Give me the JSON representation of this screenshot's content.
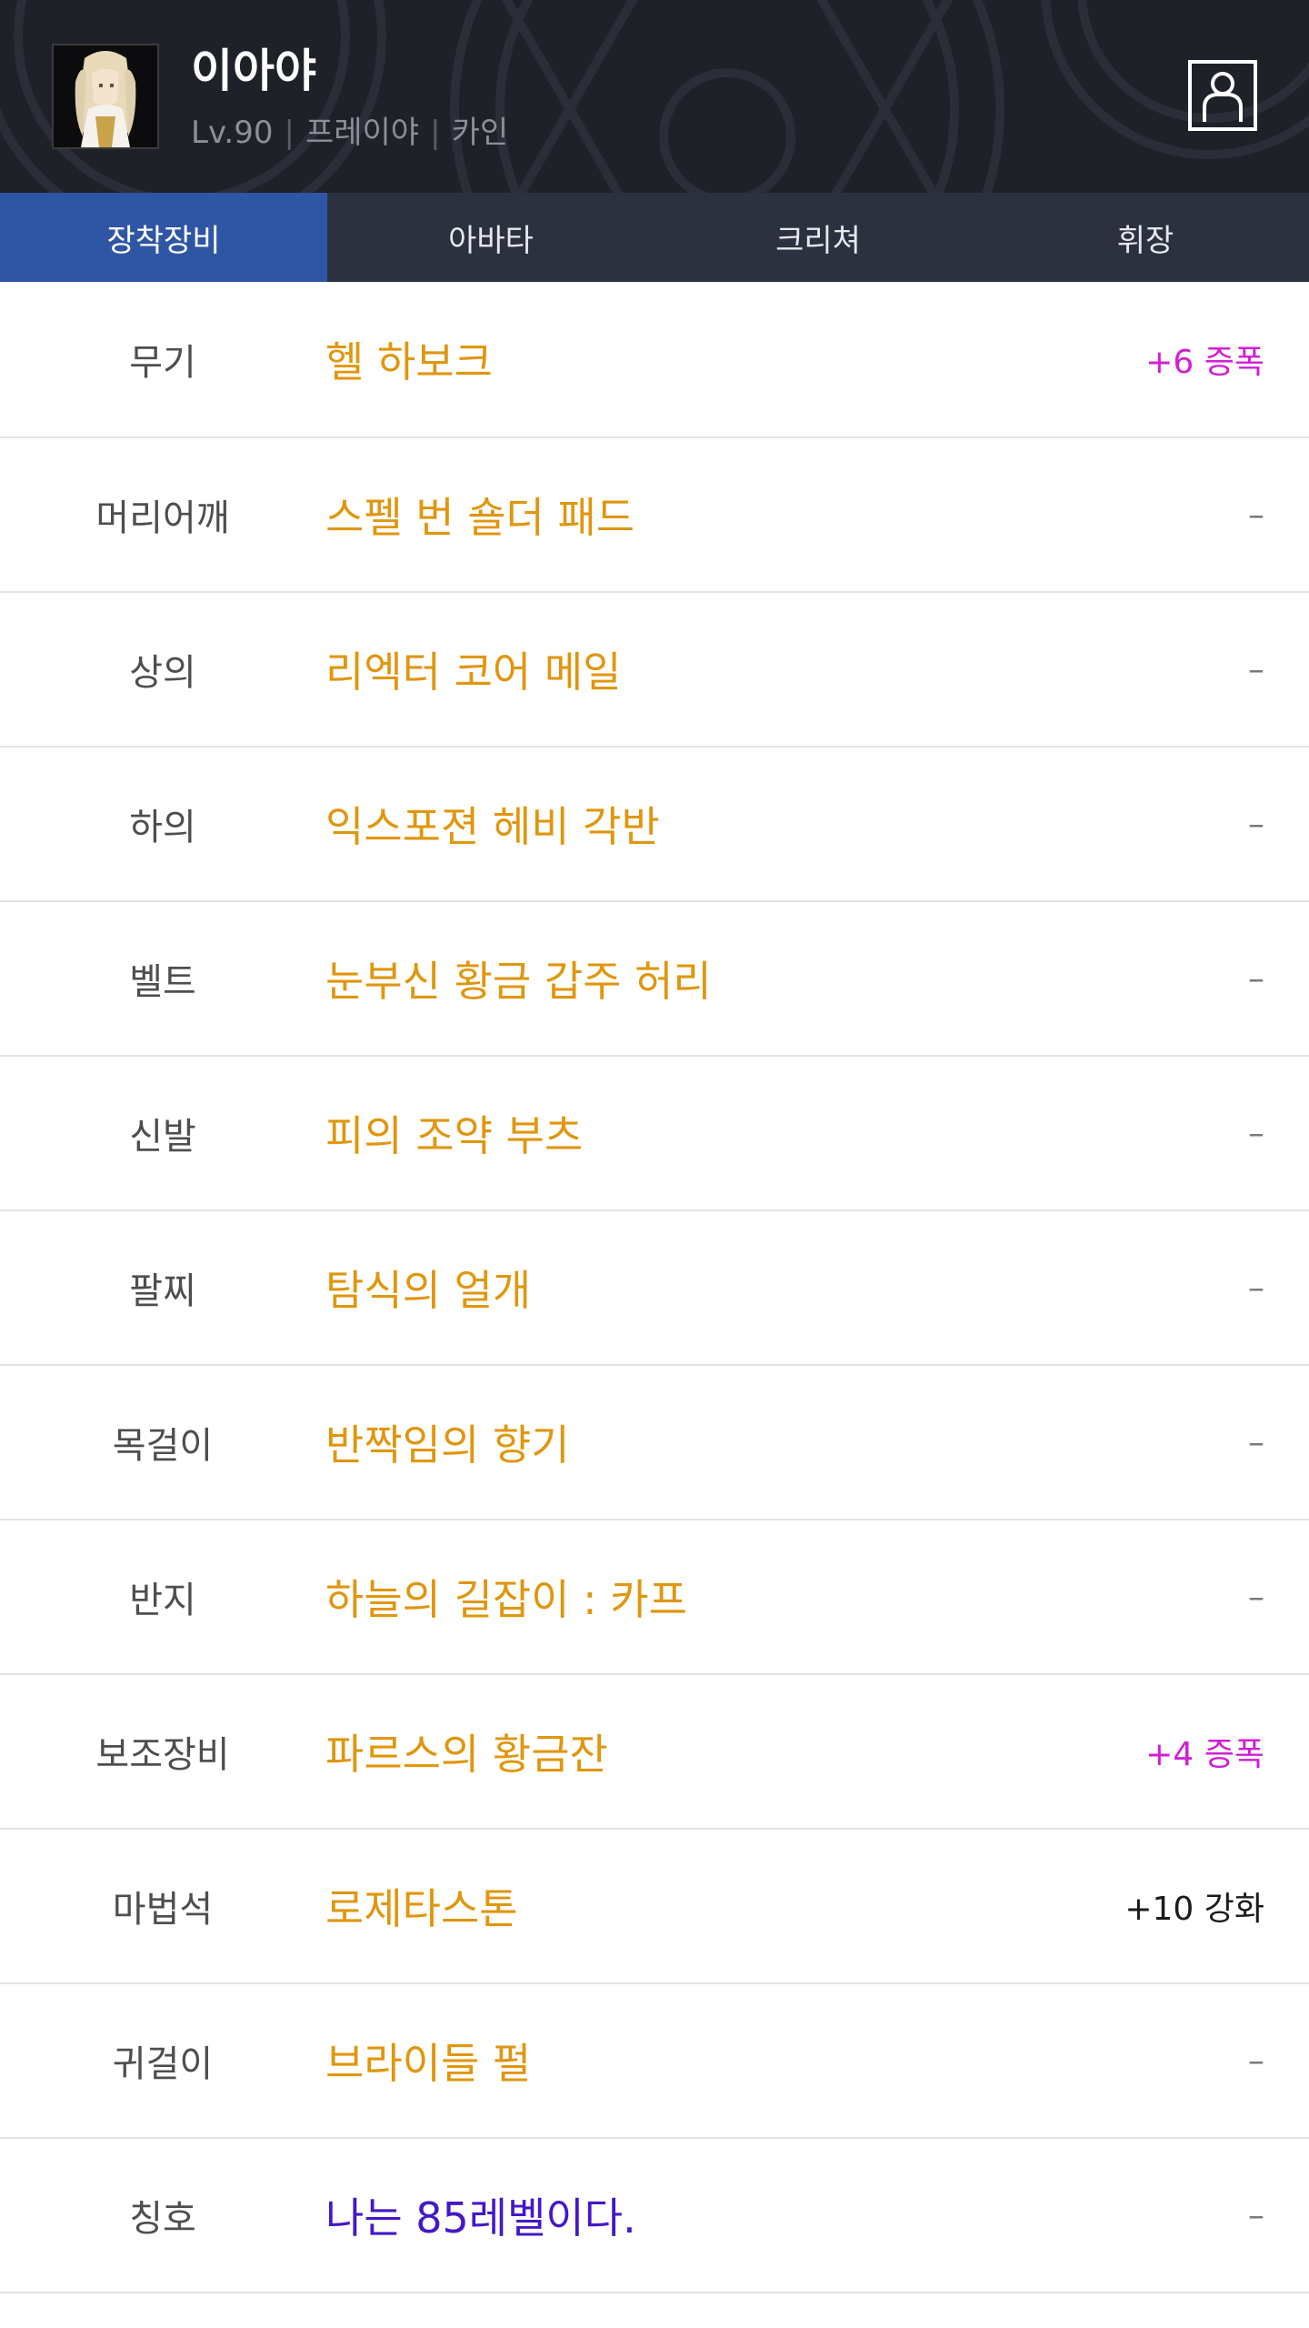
{
  "header": {
    "character_name": "이아야",
    "level": "Lv.90",
    "job": "프레이야",
    "server": "카인",
    "separator": "|",
    "profile_icon": "person-icon"
  },
  "tabs": [
    {
      "label": "장착장비",
      "active": true
    },
    {
      "label": "아바타",
      "active": false
    },
    {
      "label": "크리쳐",
      "active": false
    },
    {
      "label": "휘장",
      "active": false
    }
  ],
  "equipment": [
    {
      "slot": "무기",
      "item": "헬 하보크",
      "extra": "+6 증폭",
      "extra_type": "star"
    },
    {
      "slot": "머리어깨",
      "item": "스펠 번 숄더 패드",
      "extra": "–",
      "extra_type": "none"
    },
    {
      "slot": "상의",
      "item": "리엑터 코어 메일",
      "extra": "–",
      "extra_type": "none"
    },
    {
      "slot": "하의",
      "item": "익스포젼 헤비 각반",
      "extra": "–",
      "extra_type": "none"
    },
    {
      "slot": "벨트",
      "item": "눈부신 황금 갑주 허리",
      "extra": "–",
      "extra_type": "none"
    },
    {
      "slot": "신발",
      "item": "피의 조약 부츠",
      "extra": "–",
      "extra_type": "none"
    },
    {
      "slot": "팔찌",
      "item": "탐식의 얼개",
      "extra": "–",
      "extra_type": "none"
    },
    {
      "slot": "목걸이",
      "item": "반짝임의 향기",
      "extra": "–",
      "extra_type": "none"
    },
    {
      "slot": "반지",
      "item": "하늘의 길잡이 : 카프",
      "extra": "–",
      "extra_type": "none"
    },
    {
      "slot": "보조장비",
      "item": "파르스의 황금잔",
      "extra": "+4 증폭",
      "extra_type": "star"
    },
    {
      "slot": "마법석",
      "item": "로제타스톤",
      "extra": "+10 강화",
      "extra_type": "enhance"
    },
    {
      "slot": "귀걸이",
      "item": "브라이들 펄",
      "extra": "–",
      "extra_type": "none"
    },
    {
      "slot": "칭호",
      "item": "나는 85레벨이다.",
      "extra": "–",
      "extra_type": "none",
      "item_style": "title"
    }
  ],
  "colors": {
    "header_bg": "#1f2129",
    "tab_bg": "#2c3140",
    "tab_active_bg": "#2f56a4",
    "item_text": "#e0960e",
    "title_item_text": "#4418c8",
    "amplify_text": "#d21ed6"
  }
}
